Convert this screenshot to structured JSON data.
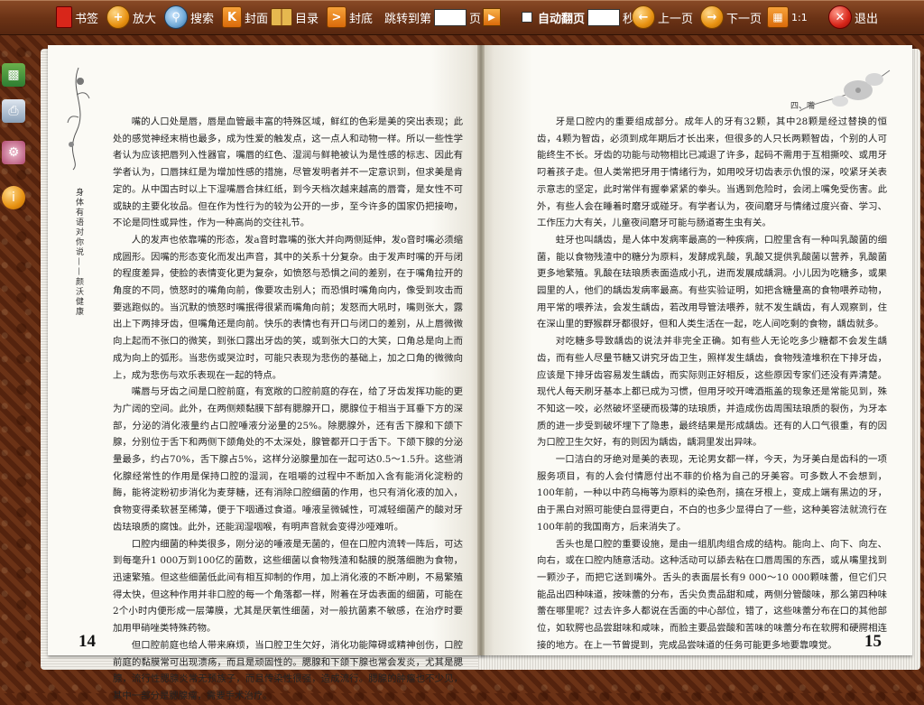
{
  "toolbar": {
    "bookmark": "书签",
    "zoom_in": "放大",
    "search": "搜索",
    "cover": "封面",
    "toc": "目录",
    "back_cover": "封底",
    "jump_prefix": "跳转到第",
    "jump_suffix": "页",
    "auto_flip": "自动翻页",
    "seconds": "秒",
    "prev_page": "上一页",
    "next_page": "下一页",
    "ratio": "1:1",
    "exit": "退出"
  },
  "book": {
    "left_vertical_title": "身体有语对你说——颜沃健康",
    "right_header": "四、嘴",
    "left_page_number": "14",
    "right_page_number": "15",
    "left_paragraphs": [
      "嘴的人口处是唇，唇是血管最丰富的特殊区域，鲜红的色彩是美的突出表现；此处的感觉神经末梢也最多，成为性爱的触发点，这一点人和动物一样。所以一些性学者认为应该把唇列入性器官，嘴唇的红色、湿润与鲜艳被认为是性感的标志、因此有学者认为，口唇抹红是为增加性感的措施，尽管发明者并不一定意识到，但求美是肯定的。从中国古时以上下湿嘴唇合抹红纸，到今天档次越来越高的唇膏，是女性不可或缺的主要化妆品。但在作为性行为的较为公开的一步，至今许多的国家仍把接吻，不论是同性或异性，作为一种高尚的交往礼节。",
      "人的发声也依靠嘴的形态，发a音时靠嘴的张大并向两侧延伸，发o音时嘴必须缩成圆形。因嘴的形态变化而发出声音，其中的关系十分复杂。由于发声时嘴的开与闭的程度差异，使脸的表情变化更为复杂，如愤怒与恐惧之间的差别，在于嘴角拉开的角度的不同，愤怒时的嘴角向前，像要攻击别人；而恐惧时嘴角向内，像受到攻击而要逃跑似的。当沉默的愤怒时嘴抿得很紧而嘴角向前；发怒而大吼时，嘴则张大，露出上下两排牙齿，但嘴角还是向前。快乐的表情也有开口与闭口的差别，从上唇微微向上起而不张口的微笑，到张口露出牙齿的笑，或到张大口的大笑，口角总是向上而成为向上的弧形。当悲伤或哭泣时，可能只表现为悲伤的基础上，加之口角的微微向上，成为悲伤与欢乐表现在一起的特点。",
      "嘴唇与牙齿之间是口腔前庭，有宽敞的口腔前庭的存在，给了牙齿发挥功能的更为广阔的空间。此外，在两侧颊黏膜下部有腮腺开口，腮腺位于相当于耳垂下方的深部，分泌的消化液量约占口腔唾液分泌量的25%。除腮腺外，还有舌下腺和下颌下腺，分别位于舌下和两侧下颌角处的不太深处，腺管都开口于舌下。下颌下腺的分泌量最多，约占70%，舌下腺占5%，这样分泌腺量加在一起可达0.5～1.5升。这些消化腺经常性的作用是保持口腔的湿润，在咀嚼的过程中不断加入含有能消化淀粉的酶，能将淀粉初步消化为麦芽糖，还有消除口腔细菌的作用，也只有消化液的加入，食物变得柔软甚至稀薄，便于下咽通过食道。唾液呈微碱性，可减轻细菌产的酸对牙齿珐琅质的腐蚀。此外，还能润湿咽喉，有明声音就会变得沙哑难听。",
      "口腔内细菌的种类很多，刚分泌的唾液是无菌的，但在口腔内流转一阵后，可达到每毫升1 000万到100亿的菌数，这些细菌以食物残渣和黏膜的脱落细胞为食物，迅速繁殖。但这些细菌低此间有相互抑制的作用，加上消化液的不断冲刷，不易繁殖得太快，但这种作用并非口腔的每一个角落都一样，附着在牙齿表面的细菌，可能在2个小时内便形成一层薄膜，尤其是厌氧性细菌，对一般抗菌素不敏感，在治疗时要加用甲硝唑类特殊药物。",
      "但口腔前庭也给人带来麻烦，当口腔卫生欠好，消化功能障碍或精神创伤，口腔前庭的黏膜常可出现溃疡，而且是顽固性的。腮腺和下颌下腺也常会发炎，尤其是腮腺，流行性腮腺炎常无预族子，而且传染性很强，造成流行。腮腺的肿瘤也不少见，其中一部分是腮腺瘤，需要手术治疗。"
    ],
    "right_paragraphs": [
      "牙是口腔内的重要组成部分。成年人的牙有32颗，其中28颗是经过替换的恒齿，4颗为智齿，必须到成年期后才长出来，但很多的人只长两颗智齿，个别的人可能终生不长。牙齿的功能与动物相比已减退了许多，起码不需用于互相撕咬、或用牙叼着孩子走。但人类常把牙用于情绪行为，如用咬牙切齿表示仇恨的深，咬紧牙关表示意志的坚定，此时常伴有握拳紧紧的拳头。当遇到危险时，会闭上嘴免受伤害。此外，有些人会在睡着时磨牙或碰牙。有学者认为，夜间磨牙与情绪过度兴奋、学习、工作压力大有关，儿童夜间磨牙可能与肠道寄生虫有关。",
      "蛀牙也叫龋齿，是人体中发病率最高的一种疾病，口腔里含有一种叫乳酸菌的细菌，能以食物残渣中的糖分为原料，发酵成乳酸，乳酸又提供乳酸菌以营养，乳酸菌更多地繁殖。乳酸在珐琅质表面造成小孔，进而发展成龋洞。小儿因为吃糖多，或果园里的人，他们的龋齿发病率最高。有些实验证明，如把含糖量高的食物喂养动物，用平常的喂养法，会发生龋齿，若改用导管法喂养，就不发生龋齿，有人观察到，住在深山里的野猴群牙都很好，但和人类生活在一起，吃人间吃剩的食物，龋齿就多。",
      "对吃糖多导致龋齿的说法并非完全正确。如有些人无论吃多少糖都不会发生龋齿，而有些人尽量节糖又讲究牙齿卫生，照样发生龋齿，食物残渣堆积在下排牙齿，应该是下排牙齿容易发生龋齿，而实际则正好相反，这些原因专家们还没有弄清楚。现代人每天刷牙基本上都已成为习惯，但用牙咬开啤酒瓶盖的现象还是常能见到，殊不知这一咬，必然破坏坚硬而极薄的珐琅质，并造成伤齿周围珐琅质的裂伤，为牙本质的进一步受到破坏埋下了隐患，最终结果是形成龋齿。还有的人口气很重，有的因为口腔卫生欠好，有的则因为龋齿，龋洞里发出异味。",
      "一口洁白的牙绝对是美的表现，无论男女都一样，今天，为牙美白是齿科的一项服务项目，有的人会付情愿付出不菲的价格为自己的牙美容。可多数人不会想到，100年前，一种以中药乌梅等为原料的染色剂，搞在牙根上，变成上端有黑边的牙，由于黑白对照可能使白显得更白，不白的也多少显得白了一些，这种美容法就流行在100年前的我国南方，后来消失了。",
      "舌头也是口腔的重要设施，是由一组肌肉组合成的结构。能向上、向下、向左、向右，或在口腔内随意活动。这种活动可以舔去粘在口唇周围的东西，或从嘴里找到一颗沙子，而把它送到嘴外。舌头的表面层长有9 000～10 000颗味蕾，但它们只能品出四种味道，按味蕾的分布，舌尖负责品甜和咸，两侧分管酸味，那么第四种味蕾在哪里呢？过去许多人都说在舌面的中心部位，错了，这些味蕾分布在口的其他部位，如软腭也品尝甜味和咸味，而脸主要品尝酸和苦味的味蕾分布在软腭和硬腭相连接的地方。在上一节曾提到，完成品尝味道的任务可能更多地要靠嗅觉。"
    ]
  }
}
